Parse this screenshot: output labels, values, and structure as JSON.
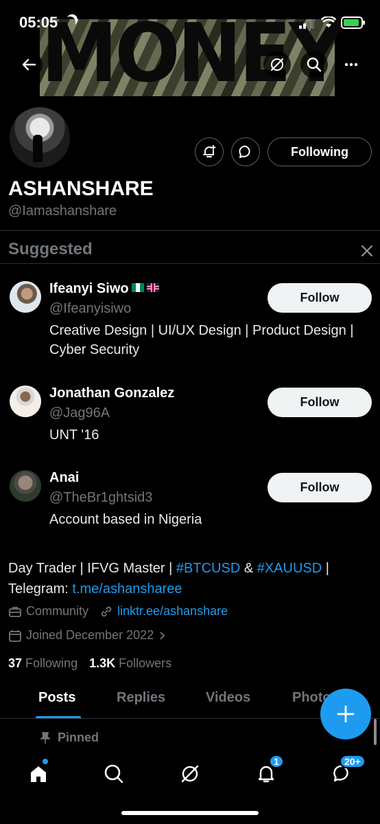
{
  "status_bar": {
    "time": "05:05"
  },
  "banner": {
    "word": "MONEY"
  },
  "profile": {
    "display_name": "ASHANSHARE",
    "handle": "@Iamashanshare",
    "following_label": "Following"
  },
  "suggested": {
    "title": "Suggested",
    "users": [
      {
        "name": "Ifeanyi Siwo",
        "handle": "@Ifeanyisiwo",
        "bio": "Creative Design | UI/UX Design | Product Design | Cyber Security",
        "follow_label": "Follow"
      },
      {
        "name": "Jonathan Gonzalez",
        "handle": "@Jag96A",
        "bio": "UNT '16",
        "follow_label": "Follow"
      },
      {
        "name": "Anai",
        "handle": "@TheBr1ghtsid3",
        "bio": "Account based in Nigeria",
        "follow_label": "Follow"
      }
    ]
  },
  "bio": {
    "line1_text": "Day Trader | IFVG Master | ",
    "tag1": "#BTCUSD",
    "amp": " & ",
    "tag2": "#XAUUSD",
    "line1_end": " |",
    "line2_text": "Telegram: ",
    "telegram_link": "t.me/ashanshareе"
  },
  "meta": {
    "category": "Community",
    "website": "linktr.ee/ashanshare",
    "joined": "Joined December 2022"
  },
  "stats": {
    "following_count": "37",
    "following_label": "Following",
    "followers_count": "1.3K",
    "followers_label": "Followers"
  },
  "tabs": [
    "Posts",
    "Replies",
    "Videos",
    "Photos"
  ],
  "pinned_label": "Pinned",
  "bottom_nav": {
    "notifications_badge": "1",
    "messages_badge": "20+"
  },
  "colors": {
    "accent": "#1d9bf0",
    "muted": "#71767b",
    "background": "#000000"
  }
}
